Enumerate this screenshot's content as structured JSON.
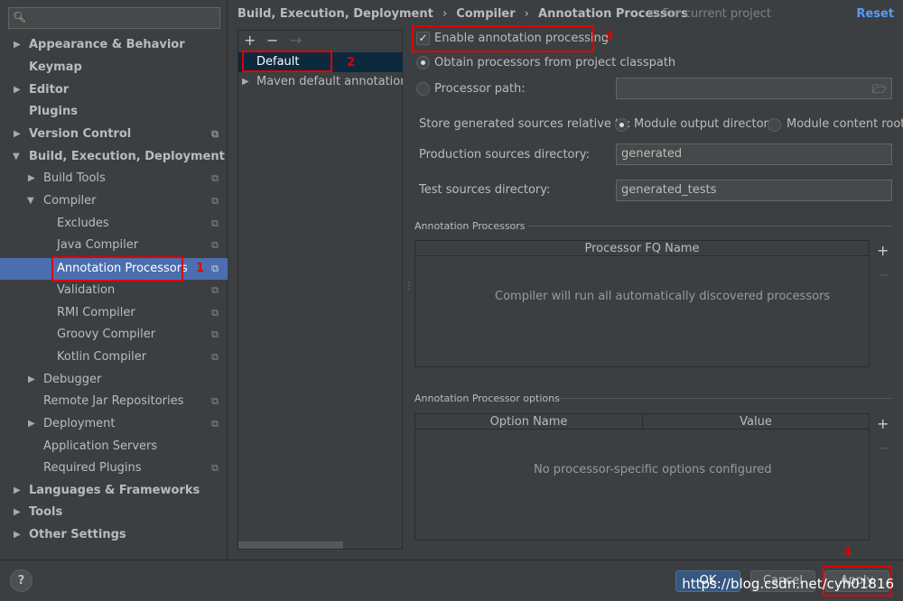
{
  "sidebar": {
    "search_placeholder": "",
    "items": [
      {
        "label": "Appearance & Behavior",
        "bold": true
      },
      {
        "label": "Keymap",
        "bold": true
      },
      {
        "label": "Editor",
        "bold": true
      },
      {
        "label": "Plugins",
        "bold": true
      },
      {
        "label": "Version Control",
        "bold": true
      },
      {
        "label": "Build, Execution, Deployment",
        "bold": true
      },
      {
        "label": "Build Tools"
      },
      {
        "label": "Compiler"
      },
      {
        "label": "Excludes"
      },
      {
        "label": "Java Compiler"
      },
      {
        "label": "Annotation Processors"
      },
      {
        "label": "Validation"
      },
      {
        "label": "RMI Compiler"
      },
      {
        "label": "Groovy Compiler"
      },
      {
        "label": "Kotlin Compiler"
      },
      {
        "label": "Debugger"
      },
      {
        "label": "Remote Jar Repositories"
      },
      {
        "label": "Deployment"
      },
      {
        "label": "Application Servers"
      },
      {
        "label": "Required Plugins"
      },
      {
        "label": "Languages & Frameworks",
        "bold": true
      },
      {
        "label": "Tools",
        "bold": true
      },
      {
        "label": "Other Settings",
        "bold": true
      }
    ]
  },
  "header": {
    "breadcrumb": [
      "Build, Execution, Deployment",
      "Compiler",
      "Annotation Processors"
    ],
    "separator": "›",
    "scope": "For current project",
    "reset": "Reset"
  },
  "profiles": {
    "add": "+",
    "remove": "−",
    "move": "→",
    "items": [
      "Default",
      "Maven default annotation processors profile"
    ]
  },
  "settings": {
    "enable_label": "Enable annotation processing",
    "obtain_label": "Obtain processors from project classpath",
    "processor_path_label": "Processor path:",
    "processor_path_value": "",
    "store_label": "Store generated sources relative to:",
    "module_output": "Module output directory",
    "module_content": "Module content root",
    "production_label": "Production sources directory:",
    "production_value": "generated",
    "test_label": "Test sources directory:",
    "test_value": "generated_tests"
  },
  "processors_group": {
    "title": "Annotation Processors",
    "column": "Processor FQ Name",
    "empty": "Compiler will run all automatically discovered processors"
  },
  "options_group": {
    "title": "Annotation Processor options",
    "col_name": "Option Name",
    "col_value": "Value",
    "empty": "No processor-specific options configured"
  },
  "footer": {
    "help": "?",
    "ok": "OK",
    "cancel": "Cancel",
    "apply": "Apply"
  },
  "annotations": [
    "1",
    "2",
    "3",
    "4"
  ],
  "watermark": "https://blog.csdn.net/cyh01816",
  "colors": {
    "background": "#3c3f41",
    "selection": "#4b6eaf",
    "highlight_box": "#e00000",
    "link": "#589df6"
  }
}
